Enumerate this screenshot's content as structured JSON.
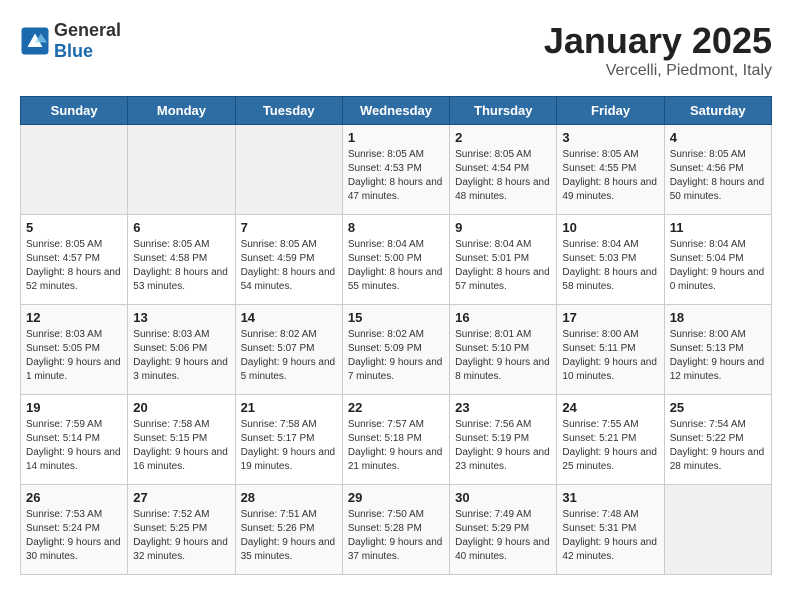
{
  "header": {
    "logo_general": "General",
    "logo_blue": "Blue",
    "title": "January 2025",
    "subtitle": "Vercelli, Piedmont, Italy"
  },
  "weekdays": [
    "Sunday",
    "Monday",
    "Tuesday",
    "Wednesday",
    "Thursday",
    "Friday",
    "Saturday"
  ],
  "weeks": [
    [
      {
        "day": "",
        "info": ""
      },
      {
        "day": "",
        "info": ""
      },
      {
        "day": "",
        "info": ""
      },
      {
        "day": "1",
        "info": "Sunrise: 8:05 AM\nSunset: 4:53 PM\nDaylight: 8 hours and 47 minutes."
      },
      {
        "day": "2",
        "info": "Sunrise: 8:05 AM\nSunset: 4:54 PM\nDaylight: 8 hours and 48 minutes."
      },
      {
        "day": "3",
        "info": "Sunrise: 8:05 AM\nSunset: 4:55 PM\nDaylight: 8 hours and 49 minutes."
      },
      {
        "day": "4",
        "info": "Sunrise: 8:05 AM\nSunset: 4:56 PM\nDaylight: 8 hours and 50 minutes."
      }
    ],
    [
      {
        "day": "5",
        "info": "Sunrise: 8:05 AM\nSunset: 4:57 PM\nDaylight: 8 hours and 52 minutes."
      },
      {
        "day": "6",
        "info": "Sunrise: 8:05 AM\nSunset: 4:58 PM\nDaylight: 8 hours and 53 minutes."
      },
      {
        "day": "7",
        "info": "Sunrise: 8:05 AM\nSunset: 4:59 PM\nDaylight: 8 hours and 54 minutes."
      },
      {
        "day": "8",
        "info": "Sunrise: 8:04 AM\nSunset: 5:00 PM\nDaylight: 8 hours and 55 minutes."
      },
      {
        "day": "9",
        "info": "Sunrise: 8:04 AM\nSunset: 5:01 PM\nDaylight: 8 hours and 57 minutes."
      },
      {
        "day": "10",
        "info": "Sunrise: 8:04 AM\nSunset: 5:03 PM\nDaylight: 8 hours and 58 minutes."
      },
      {
        "day": "11",
        "info": "Sunrise: 8:04 AM\nSunset: 5:04 PM\nDaylight: 9 hours and 0 minutes."
      }
    ],
    [
      {
        "day": "12",
        "info": "Sunrise: 8:03 AM\nSunset: 5:05 PM\nDaylight: 9 hours and 1 minute."
      },
      {
        "day": "13",
        "info": "Sunrise: 8:03 AM\nSunset: 5:06 PM\nDaylight: 9 hours and 3 minutes."
      },
      {
        "day": "14",
        "info": "Sunrise: 8:02 AM\nSunset: 5:07 PM\nDaylight: 9 hours and 5 minutes."
      },
      {
        "day": "15",
        "info": "Sunrise: 8:02 AM\nSunset: 5:09 PM\nDaylight: 9 hours and 7 minutes."
      },
      {
        "day": "16",
        "info": "Sunrise: 8:01 AM\nSunset: 5:10 PM\nDaylight: 9 hours and 8 minutes."
      },
      {
        "day": "17",
        "info": "Sunrise: 8:00 AM\nSunset: 5:11 PM\nDaylight: 9 hours and 10 minutes."
      },
      {
        "day": "18",
        "info": "Sunrise: 8:00 AM\nSunset: 5:13 PM\nDaylight: 9 hours and 12 minutes."
      }
    ],
    [
      {
        "day": "19",
        "info": "Sunrise: 7:59 AM\nSunset: 5:14 PM\nDaylight: 9 hours and 14 minutes."
      },
      {
        "day": "20",
        "info": "Sunrise: 7:58 AM\nSunset: 5:15 PM\nDaylight: 9 hours and 16 minutes."
      },
      {
        "day": "21",
        "info": "Sunrise: 7:58 AM\nSunset: 5:17 PM\nDaylight: 9 hours and 19 minutes."
      },
      {
        "day": "22",
        "info": "Sunrise: 7:57 AM\nSunset: 5:18 PM\nDaylight: 9 hours and 21 minutes."
      },
      {
        "day": "23",
        "info": "Sunrise: 7:56 AM\nSunset: 5:19 PM\nDaylight: 9 hours and 23 minutes."
      },
      {
        "day": "24",
        "info": "Sunrise: 7:55 AM\nSunset: 5:21 PM\nDaylight: 9 hours and 25 minutes."
      },
      {
        "day": "25",
        "info": "Sunrise: 7:54 AM\nSunset: 5:22 PM\nDaylight: 9 hours and 28 minutes."
      }
    ],
    [
      {
        "day": "26",
        "info": "Sunrise: 7:53 AM\nSunset: 5:24 PM\nDaylight: 9 hours and 30 minutes."
      },
      {
        "day": "27",
        "info": "Sunrise: 7:52 AM\nSunset: 5:25 PM\nDaylight: 9 hours and 32 minutes."
      },
      {
        "day": "28",
        "info": "Sunrise: 7:51 AM\nSunset: 5:26 PM\nDaylight: 9 hours and 35 minutes."
      },
      {
        "day": "29",
        "info": "Sunrise: 7:50 AM\nSunset: 5:28 PM\nDaylight: 9 hours and 37 minutes."
      },
      {
        "day": "30",
        "info": "Sunrise: 7:49 AM\nSunset: 5:29 PM\nDaylight: 9 hours and 40 minutes."
      },
      {
        "day": "31",
        "info": "Sunrise: 7:48 AM\nSunset: 5:31 PM\nDaylight: 9 hours and 42 minutes."
      },
      {
        "day": "",
        "info": ""
      }
    ]
  ]
}
